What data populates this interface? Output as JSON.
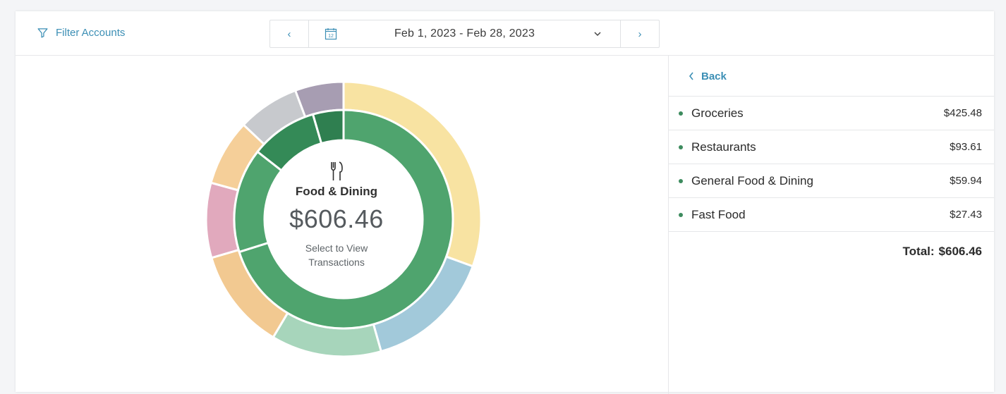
{
  "toolbar": {
    "filter_label": "Filter Accounts",
    "date_range": "Feb 1, 2023 - Feb 28, 2023",
    "calendar_day": "12",
    "prev_label": "‹",
    "next_label": "›"
  },
  "center": {
    "title": "Food & Dining",
    "amount": "$606.46",
    "subtitle_line1": "Select to View",
    "subtitle_line2": "Transactions"
  },
  "side": {
    "back_label": "Back",
    "items": [
      {
        "label": "Groceries",
        "amount": "$425.48"
      },
      {
        "label": "Restaurants",
        "amount": "$93.61"
      },
      {
        "label": "General Food & Dining",
        "amount": "$59.94"
      },
      {
        "label": "Fast Food",
        "amount": "$27.43"
      }
    ],
    "total_label": "Total:",
    "total_amount": "$606.46"
  },
  "chart_data": {
    "type": "donut",
    "inner_ring": {
      "series": [
        {
          "name": "Groceries",
          "value": 425.48,
          "color": "#4fa46e"
        },
        {
          "name": "Restaurants",
          "value": 93.61,
          "color": "#4fa46e"
        },
        {
          "name": "General Food & Dining",
          "value": 59.94,
          "color": "#348a57"
        },
        {
          "name": "Fast Food",
          "value": 27.43,
          "color": "#2f7f50"
        }
      ],
      "total": 606.46
    },
    "outer_ring": {
      "slices": [
        {
          "value": 29.5,
          "color": "#f8e3a2"
        },
        {
          "value": 14.5,
          "color": "#a2c9da"
        },
        {
          "value": 12.5,
          "color": "#a7d5bb"
        },
        {
          "value": 11.5,
          "color": "#f2c991"
        },
        {
          "value": 8.5,
          "color": "#e1a9bd"
        },
        {
          "value": 7.5,
          "color": "#f5cf99"
        },
        {
          "value": 7.0,
          "color": "#c7c9cd"
        },
        {
          "value": 5.5,
          "color": "#a79db2"
        }
      ]
    },
    "colors": {
      "accent": "#3c8fb5",
      "primary_green": "#4fa46e"
    }
  }
}
